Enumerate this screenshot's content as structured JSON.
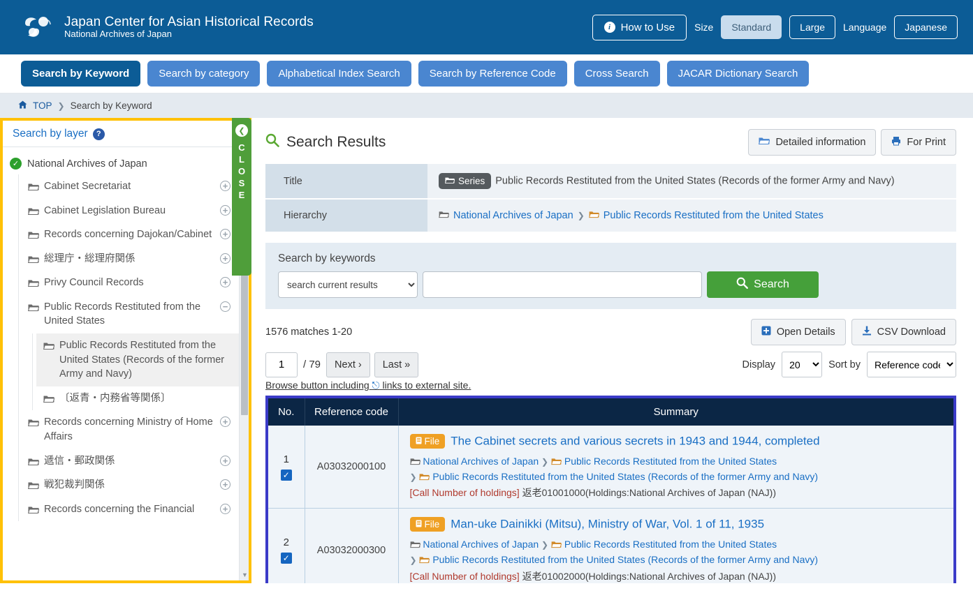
{
  "header": {
    "brand_title": "Japan Center for Asian Historical Records",
    "brand_sub": "National Archives of Japan",
    "how_to_use": "How to Use",
    "size_label": "Size",
    "size_standard": "Standard",
    "size_large": "Large",
    "language_label": "Language",
    "language_value": "Japanese",
    "bg_color": "#0c5c96"
  },
  "nav": {
    "tabs": [
      {
        "label": "Search by Keyword",
        "selected": true
      },
      {
        "label": "Search by category",
        "selected": false
      },
      {
        "label": "Alphabetical Index Search",
        "selected": false
      },
      {
        "label": "Search by Reference Code",
        "selected": false
      },
      {
        "label": "Cross Search",
        "selected": false
      },
      {
        "label": "JACAR Dictionary Search",
        "selected": false
      }
    ],
    "tab_color": "#4a86d0",
    "selected_color": "#0c5c96"
  },
  "breadcrumb": {
    "home": "TOP",
    "separator": "❯",
    "current": "Search by Keyword"
  },
  "sidebar": {
    "panel_title": "Search by layer",
    "help_glyph": "?",
    "border_color": "#ffc107",
    "close_tab_label": "CLOSE",
    "close_tab_color": "#4f9e3a",
    "root": "National Archives of Japan",
    "items": [
      {
        "label": "Cabinet Secretariat",
        "toggle": "+",
        "level": 1,
        "selected": false
      },
      {
        "label": "Cabinet Legislation Bureau",
        "toggle": "+",
        "level": 1,
        "selected": false
      },
      {
        "label": "Records concerning Dajokan/Cabinet",
        "toggle": "+",
        "level": 1,
        "selected": false
      },
      {
        "label": "総理庁・総理府関係",
        "toggle": "+",
        "level": 1,
        "selected": false
      },
      {
        "label": "Privy Council Records",
        "toggle": "+",
        "level": 1,
        "selected": false
      },
      {
        "label": "Public Records Restituted from the United States",
        "toggle": "−",
        "level": 1,
        "selected": false
      },
      {
        "label": "Public Records Restituted from the United States (Records of the former Army and Navy)",
        "toggle": "",
        "level": 2,
        "selected": true
      },
      {
        "label": "〔返青・内務省等関係〕",
        "toggle": "",
        "level": 2,
        "selected": false
      },
      {
        "label": "Records concerning Ministry of Home Affairs",
        "toggle": "+",
        "level": 1,
        "selected": false
      },
      {
        "label": "遞信・郵政関係",
        "toggle": "+",
        "level": 1,
        "selected": false
      },
      {
        "label": "戦犯裁判関係",
        "toggle": "+",
        "level": 1,
        "selected": false
      },
      {
        "label": "Records concerning the Financial",
        "toggle": "+",
        "level": 1,
        "selected": false
      }
    ]
  },
  "main": {
    "results_title": "Search Results",
    "detailed_info_button": "Detailed information",
    "for_print_button": "For Print",
    "info_rows": [
      {
        "key": "Title",
        "badge": "Series",
        "value": "Public Records Restituted from the United States (Records of the former Army and Navy)"
      },
      {
        "key": "Hierarchy",
        "badge": "",
        "value": ""
      }
    ],
    "hierarchy": [
      "National Archives of Japan",
      "Public Records Restituted from the United States"
    ],
    "keyword_panel": {
      "label": "Search by keywords",
      "scope_selected": "search current results",
      "input_value": "",
      "input_placeholder": "",
      "search_button": "Search"
    },
    "counts": {
      "matches_text": "1576 matches 1-20",
      "open_details": "Open Details",
      "csv_download": "CSV Download"
    },
    "paging": {
      "current_page": "1",
      "total_pages": "/ 79",
      "next": "Next ›",
      "last": "Last »",
      "display_label": "Display",
      "display_value": "20",
      "sort_label": "Sort by",
      "sort_value": "Reference code"
    },
    "browse_note": "Browse button including",
    "browse_note_tail": "links to external site.",
    "results_border_color": "#3b3bc8",
    "table": {
      "columns": [
        "No.",
        "Reference code",
        "Summary"
      ],
      "rows": [
        {
          "no": "1",
          "checked": true,
          "ref": "A03032000100",
          "badge": "File",
          "title": "The Cabinet secrets and various secrets in 1943 and 1944, completed",
          "path1": "National Archives of Japan",
          "path2": "Public Records Restituted from the United States",
          "path3": "Public Records Restituted from the United States (Records of the former Army and Navy)",
          "call_label": "[Call Number of holdings]",
          "call_value": "返老01001000(Holdings:National Archives of Japan (NAJ))"
        },
        {
          "no": "2",
          "checked": true,
          "ref": "A03032000300",
          "badge": "File",
          "title": "Man-uke Dainikki (Mitsu), Ministry of War, Vol. 1 of 11, 1935",
          "path1": "National Archives of Japan",
          "path2": "Public Records Restituted from the United States",
          "path3": "Public Records Restituted from the United States (Records of the former Army and Navy)",
          "call_label": "[Call Number of holdings]",
          "call_value": "返老01002000(Holdings:National Archives of Japan (NAJ))"
        }
      ]
    }
  }
}
